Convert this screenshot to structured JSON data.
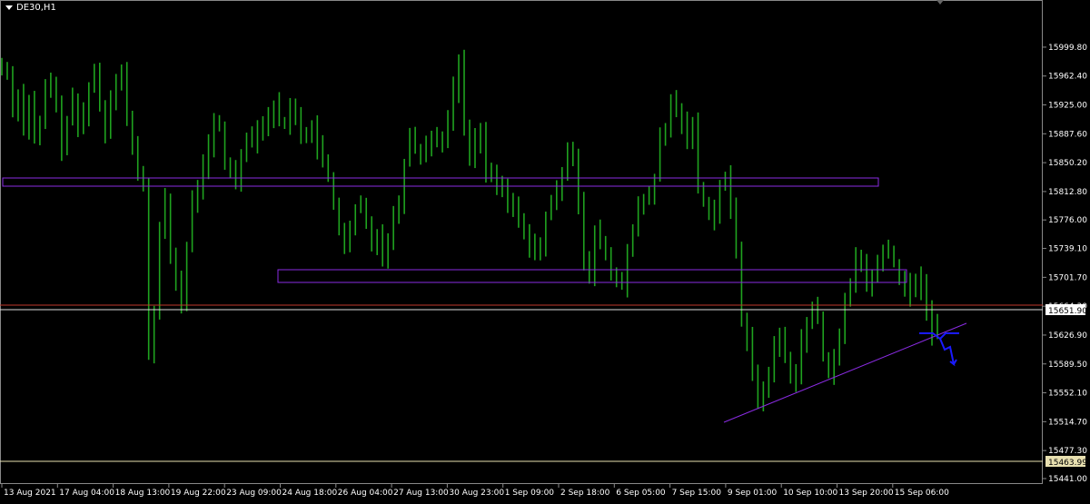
{
  "window": {
    "symbol_title": "DE30,H1"
  },
  "chart_data": {
    "type": "bar",
    "title": "DE30,H1",
    "ylim": [
      15441.0,
      16035.0
    ],
    "y_ticks": [
      "15999.80",
      "15962.40",
      "15925.00",
      "15887.60",
      "15850.20",
      "15812.80",
      "15776.00",
      "15739.10",
      "15701.70",
      "15664.30",
      "15626.90",
      "15589.50",
      "15552.10",
      "15514.70",
      "15477.30",
      "15441.00"
    ],
    "x_ticks": [
      "13 Aug 2021",
      "17 Aug 04:00",
      "18 Aug 13:00",
      "19 Aug 22:00",
      "23 Aug 09:00",
      "24 Aug 18:00",
      "26 Aug 04:00",
      "27 Aug 13:00",
      "30 Aug 23:00",
      "1 Sep 09:00",
      "2 Sep 18:00",
      "6 Sep 05:00",
      "7 Sep 15:00",
      "9 Sep 01:00",
      "10 Sep 10:00",
      "13 Sep 20:00",
      "15 Sep 06:00"
    ],
    "current_price": "15651.90",
    "level_line": "15463.99",
    "series": [
      {
        "values": [
          15975,
          15965,
          15920,
          15940,
          15895,
          15930,
          15880,
          15900,
          15945,
          15955,
          15920,
          15870,
          15905,
          15930,
          15895,
          15915,
          15948,
          15968,
          15925,
          15890,
          15935,
          15960,
          15970,
          15905,
          15870,
          15840,
          15820,
          15600,
          15660,
          15760,
          15800,
          15730,
          15700,
          15665,
          15740,
          15800,
          15820,
          15845,
          15870,
          15900,
          15895,
          15850,
          15840,
          15830,
          15860,
          15885,
          15880,
          15900,
          15895,
          15910,
          15925,
          15905,
          15900,
          15920,
          15915,
          15890,
          15880,
          15900,
          15870,
          15850,
          15830,
          15800,
          15765,
          15740,
          15760,
          15790,
          15795,
          15770,
          15745,
          15760,
          15730,
          15750,
          15780,
          15800,
          15850,
          15890,
          15870,
          15860,
          15875,
          15880,
          15885,
          15880,
          15905,
          15945,
          15980,
          15895,
          15860,
          15880,
          15890,
          15840,
          15830,
          15820,
          15815,
          15800,
          15790,
          15780,
          15760,
          15745,
          15730,
          15740,
          15780,
          15800,
          15810,
          15840,
          15870,
          15860,
          15800,
          15720,
          15700,
          15760,
          15750,
          15730,
          15705,
          15700,
          15690,
          15740,
          15760,
          15790,
          15800,
          15810,
          15830,
          15880,
          15890,
          15930,
          15920,
          15900,
          15885,
          15900,
          15820,
          15800,
          15790,
          15780,
          15820,
          15830,
          15790,
          15740,
          15650,
          15620,
          15580,
          15540,
          15555,
          15580,
          15610,
          15625,
          15600,
          15570,
          15580,
          15620,
          15640,
          15660,
          15650,
          15600,
          15580,
          15600,
          15620,
          15670,
          15690,
          15730,
          15720,
          15690,
          15700,
          15720,
          15740,
          15730,
          15720,
          15700,
          15690,
          15680,
          15700,
          15690,
          15660,
          15630,
          15650
        ]
      }
    ]
  }
}
